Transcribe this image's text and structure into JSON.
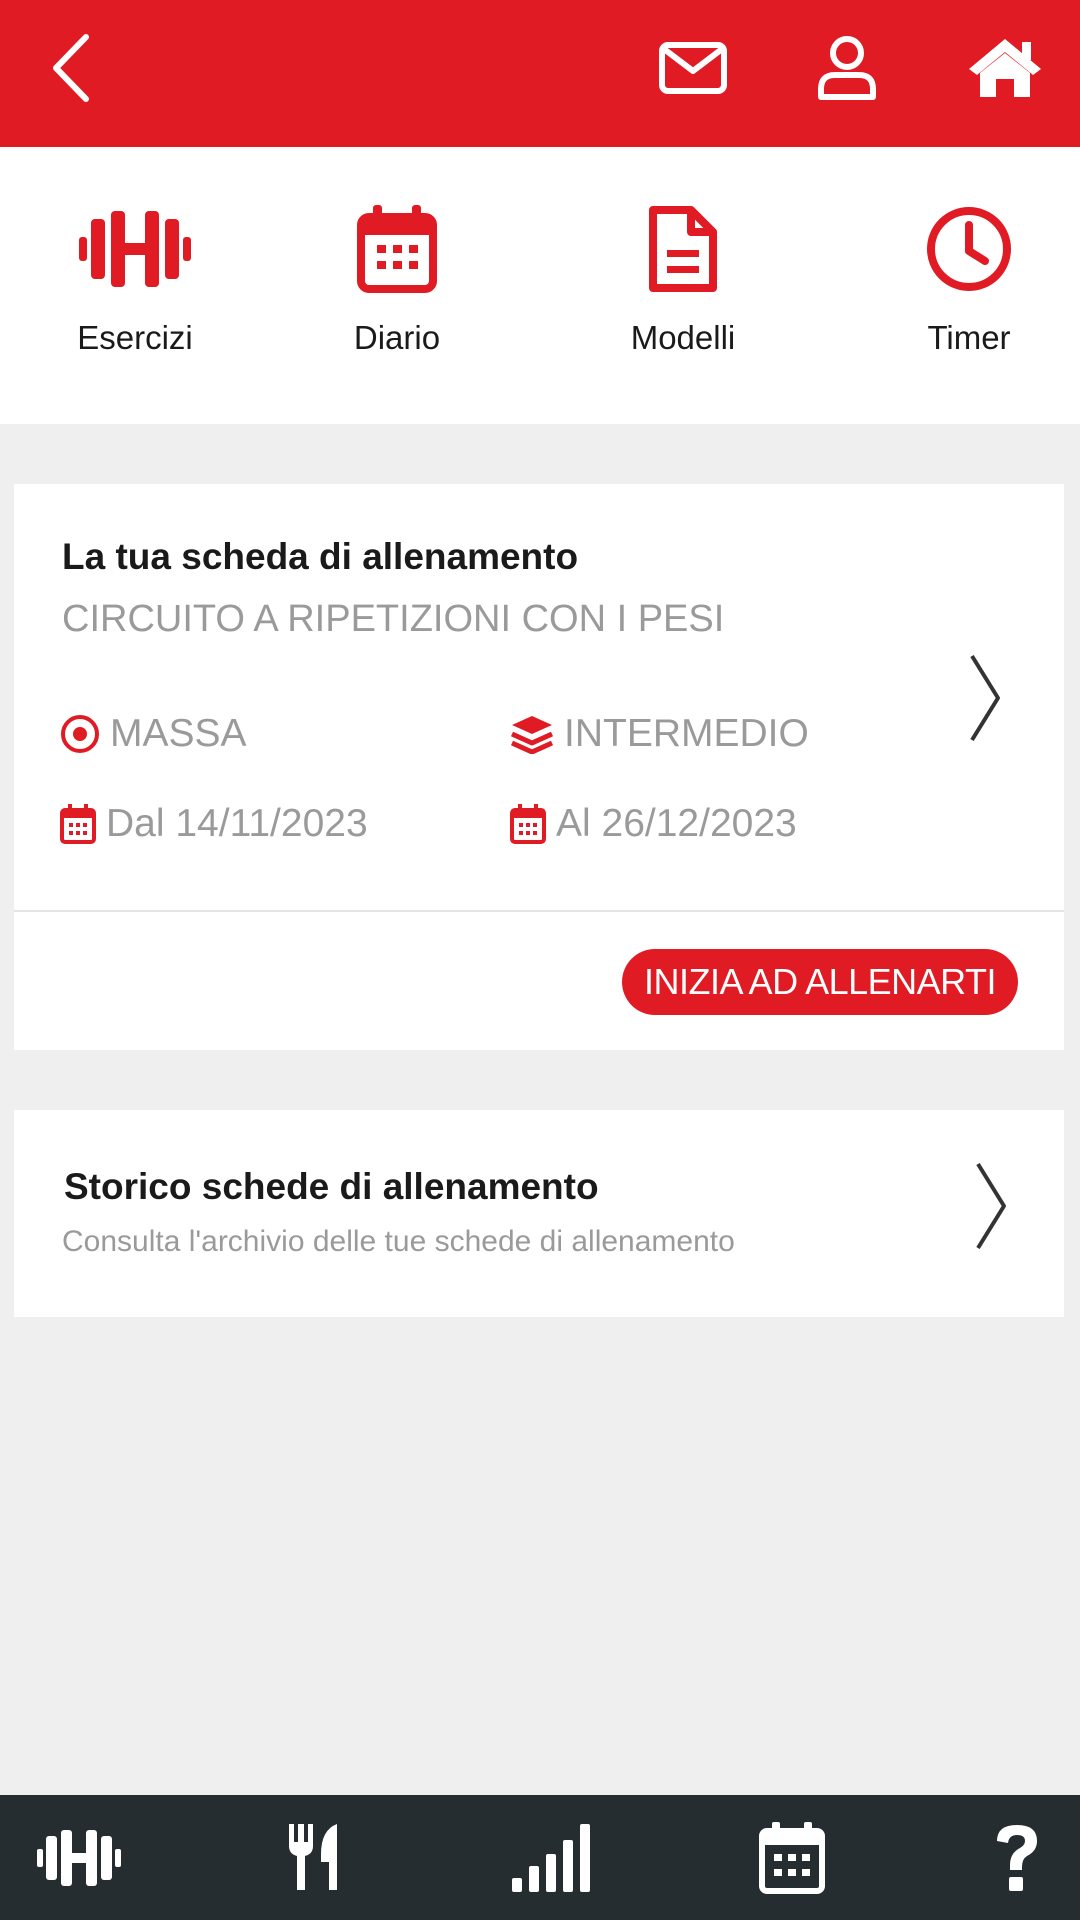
{
  "topbar": {
    "color": "#e01b24",
    "icons": [
      "back-icon",
      "mail-icon",
      "user-icon",
      "home-icon"
    ]
  },
  "quicknav": [
    {
      "label": "Esercizi",
      "icon": "dumbbell-icon"
    },
    {
      "label": "Diario",
      "icon": "calendar-icon"
    },
    {
      "label": "Modelli",
      "icon": "document-icon"
    },
    {
      "label": "Timer",
      "icon": "clock-icon"
    }
  ],
  "current_plan": {
    "heading": "La tua scheda di allenamento",
    "name": "CIRCUITO A RIPETIZIONI CON I PESI",
    "goal": "MASSA",
    "level": "INTERMEDIO",
    "start": "Dal 14/11/2023",
    "end": "Al 26/12/2023",
    "cta": "INIZIA AD ALLENARTI"
  },
  "history": {
    "heading": "Storico schede di allenamento",
    "description": "Consulta l'archivio delle tue schede di allenamento"
  },
  "bottombar": {
    "color": "#262d31",
    "icons": [
      "dumbbell-icon",
      "fork-knife-icon",
      "signal-bars-icon",
      "calendar-icon",
      "help-icon"
    ]
  }
}
